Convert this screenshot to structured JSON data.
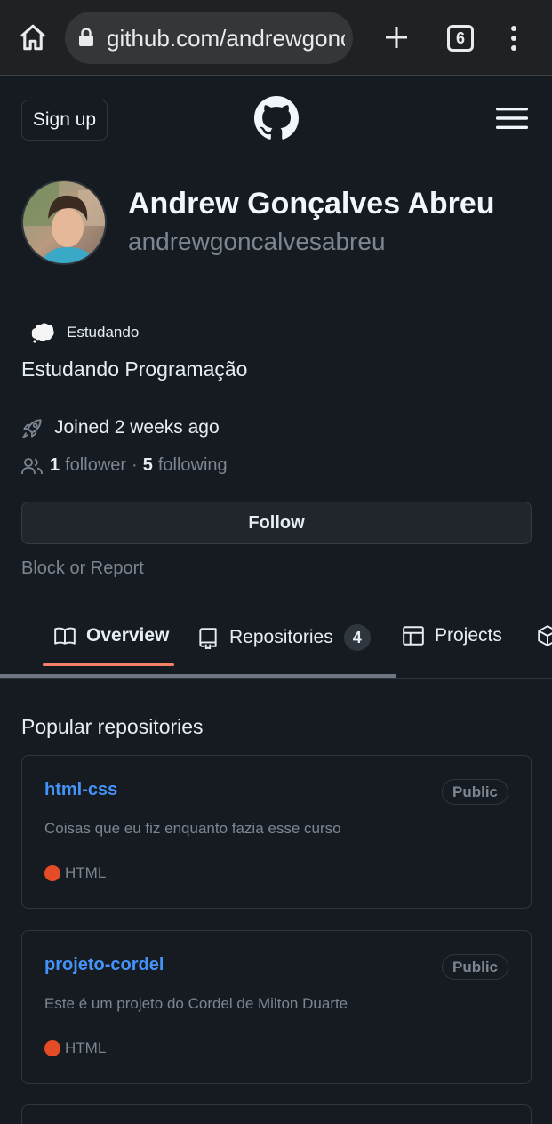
{
  "browser": {
    "url": "github.com/andrewgonc",
    "tab_count": "6"
  },
  "header": {
    "signup_label": "Sign up"
  },
  "profile": {
    "full_name": "Andrew Gonçalves Abreu",
    "username": "andrewgoncalvesabreu",
    "status": "Estudando",
    "bio": "Estudando Programação",
    "joined": "Joined 2 weeks ago",
    "followers_count": "1",
    "followers_label": "follower",
    "separator": "·",
    "following_count": "5",
    "following_label": "following",
    "follow_button": "Follow",
    "block_report": "Block or Report"
  },
  "tabs": [
    {
      "label": "Overview",
      "icon": "book-icon",
      "selected": true
    },
    {
      "label": "Repositories",
      "icon": "repo-icon",
      "counter": "4"
    },
    {
      "label": "Projects",
      "icon": "table-icon"
    },
    {
      "label": "",
      "icon": "package-icon"
    }
  ],
  "popular": {
    "heading": "Popular repositories",
    "repos": [
      {
        "name": "html-css",
        "visibility": "Public",
        "description": "Coisas que eu fiz enquanto fazia esse curso",
        "language": "HTML",
        "language_color": "#e34c26"
      },
      {
        "name": "projeto-cordel",
        "visibility": "Public",
        "description": "Este é um projeto do Cordel de Milton Duarte",
        "language": "HTML",
        "language_color": "#e34c26"
      }
    ]
  },
  "colors": {
    "background": "#161b22",
    "link": "#4493f8",
    "tab_underline": "#f78166",
    "muted": "#7d8590"
  }
}
